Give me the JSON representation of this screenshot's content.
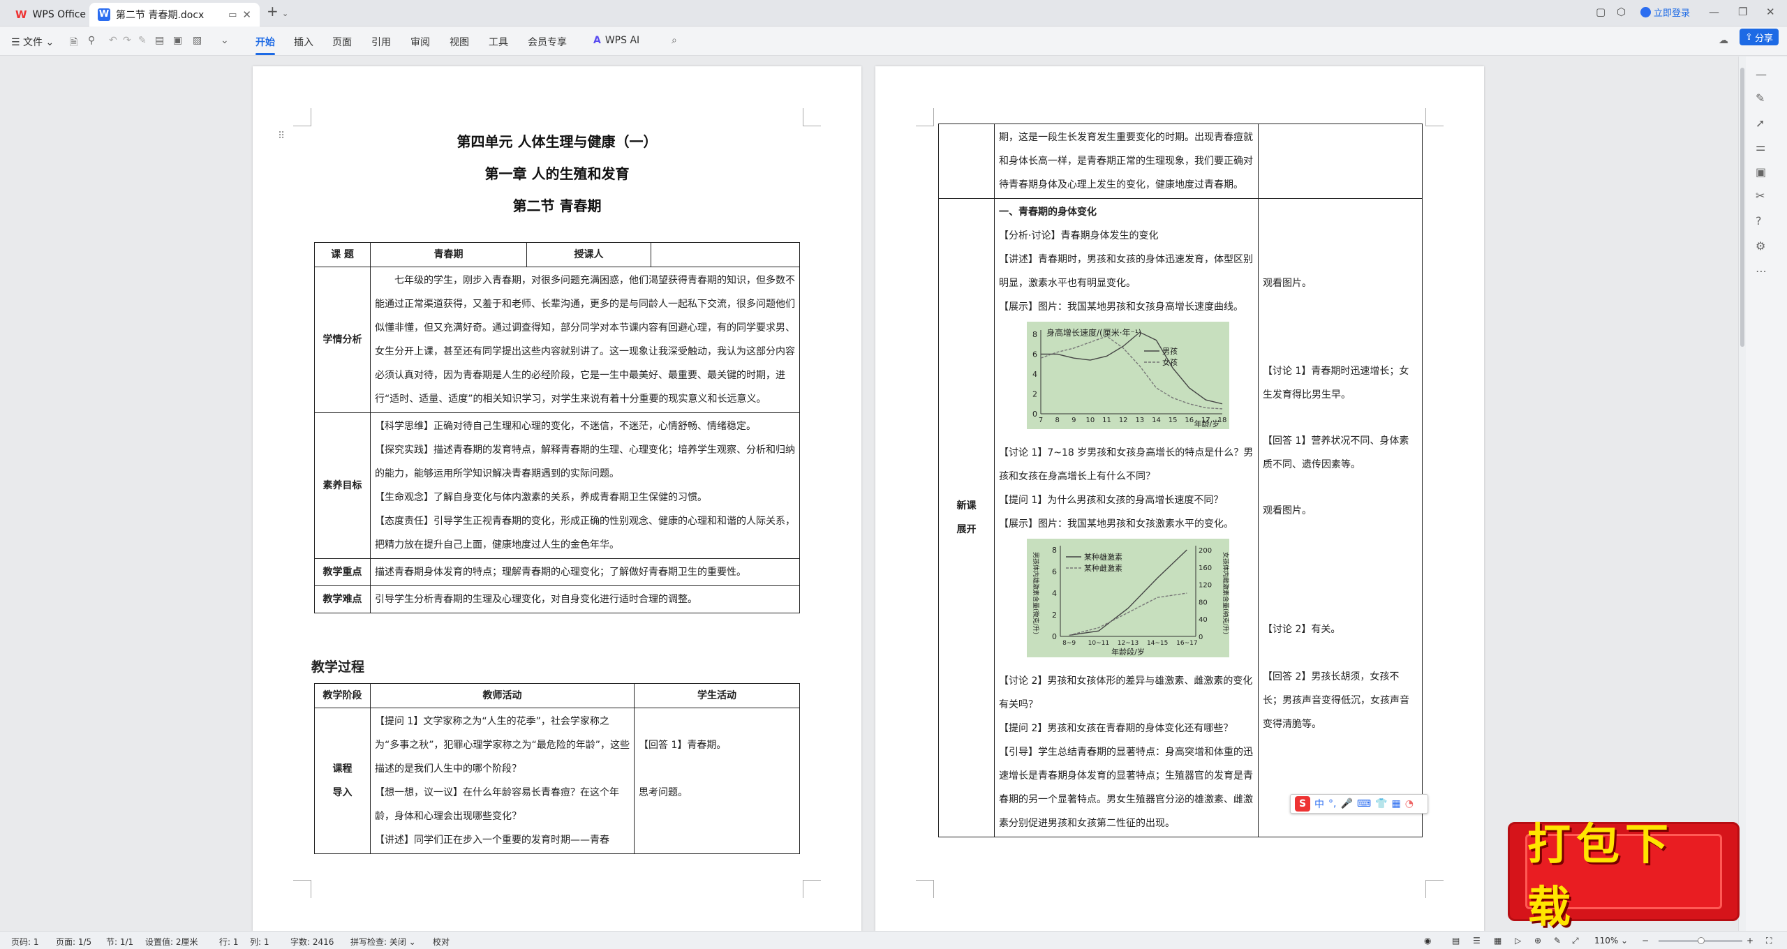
{
  "titlebar": {
    "app_tab": "WPS Office",
    "doc_tab": "第二节  青春期.docx",
    "login": "立即登录"
  },
  "ribbon": {
    "file": "文件",
    "tabs": [
      "开始",
      "插入",
      "页面",
      "引用",
      "审阅",
      "视图",
      "工具",
      "会员专享"
    ],
    "ai": "WPS AI",
    "share": "分享"
  },
  "page1": {
    "title1": "第四单元  人体生理与健康（一）",
    "title2": "第一章  人的生殖和发育",
    "title3": "第二节  青春期",
    "info": {
      "h_topic": "课    题",
      "topic": "青春期",
      "h_teacher": "授课人",
      "teacher": "",
      "h_xq": "学情分析",
      "xq": "七年级的学生，刚步入青春期，对很多问题充满困惑，他们渴望获得青春期的知识，但多数不能通过正常渠道获得，又羞于和老师、长辈沟通，更多的是与同龄人一起私下交流，很多问题他们似懂非懂，但又充满好奇。通过调查得知，部分同学对本节课内容有回避心理，有的同学要求男、女生分开上课，甚至还有同学提出这些内容就别讲了。这一现象让我深受触动，我认为这部分内容必须认真对待，因为青春期是人生的必经阶段，它是一生中最美好、最重要、最关键的时期，进行“适时、适量、适度”的相关知识学习，对学生来说有着十分重要的现实意义和长远意义。",
      "h_sy": "素养目标",
      "sy": [
        "【科学思维】正确对待自己生理和心理的变化，不迷信，不迷茫，心情舒畅、情绪稳定。",
        "【探究实践】描述青春期的发育特点，解释青春期的生理、心理变化；培养学生观察、分析和归纳的能力，能够运用所学知识解决青春期遇到的实际问题。",
        "【生命观念】了解自身变化与体内激素的关系，养成青春期卫生保健的习惯。",
        "【态度责任】引导学生正视青春期的变化，形成正确的性别观念、健康的心理和和谐的人际关系，把精力放在提升自己上面，健康地度过人生的金色年华。"
      ],
      "h_zd": "教学重点",
      "zd": "描述青春期身体发育的特点；理解青春期的心理变化；了解做好青春期卫生的重要性。",
      "h_nd": "教学难点",
      "nd": "引导学生分析青春期的生理及心理变化，对自身变化进行适时合理的调整。"
    },
    "process_heading": "教学过程",
    "process": {
      "h_stage": "教学阶段",
      "h_teacher": "教师活动",
      "h_student": "学生活动",
      "stage1": "课程\n导入",
      "t1": [
        "【提问 1】文学家称之为“人生的花季”，社会学家称之为“多事之秋”，犯罪心理学家称之为“最危险的年龄”，这些描述的是我们人生中的哪个阶段？",
        "【想一想，议一议】在什么年龄容易长青春痘？在这个年龄，身体和心理会出现哪些变化？",
        "【讲述】同学们正在步入一个重要的发育时期——青春"
      ],
      "s1": [
        "【回答 1】青春期。",
        "思考问题。"
      ]
    }
  },
  "page2": {
    "cont_teacher": "期，这是一段生长发育发生重要变化的时期。出现青春痘就和身体长高一样，是青春期正常的生理现象，我们要正确对待青春期身体及心理上发生的变化，健康地度过青春期。",
    "stage2": "新课\n展开",
    "sec1": "一、青春期的身体变化",
    "t_lines": [
      "【分析·讨论】青春期身体发生的变化",
      "【讲述】青春期时，男孩和女孩的身体迅速发育，体型区别明显，激素水平也有明显变化。",
      "【展示】图片：我国某地男孩和女孩身高增长速度曲线。"
    ],
    "t_lines2": [
      "【讨论 1】7~18 岁男孩和女孩身高增长的特点是什么？男孩和女孩在身高增长上有什么不同？",
      "【提问 1】为什么男孩和女孩的身高增长速度不同？",
      "【展示】图片：我国某地男孩和女孩激素水平的变化。"
    ],
    "t_lines3": [
      "【讨论 2】男孩和女孩体形的差异与雄激素、雌激素的变化有关吗？",
      "【提问 2】男孩和女孩在青春期的身体变化还有哪些？",
      "【引导】学生总结青春期的显著特点：身高突增和体重的迅速增长是青春期身体发育的显著特点；生殖器官的发育是青春期的另一个显著特点。男女生殖器官分泌的雄激素、雌激素分别促进男孩和女孩第二性征的出现。"
    ],
    "s_lines": {
      "a": "观看图片。",
      "b": "【讨论 1】青春期时迅速增长；女生发育得比男生早。",
      "c": "【回答 1】营养状况不同、身体素质不同、遗传因素等。",
      "d": "观看图片。",
      "e": "【讨论 2】有关。",
      "f": "【回答 2】男孩长胡须，女孩不长；男孩声音变得低沉，女孩声音变得清脆等。"
    }
  },
  "chart_data": [
    {
      "type": "line",
      "title": "身高增长速度/(厘米·年⁻¹)",
      "xlabel": "年龄/岁",
      "x": [
        7,
        8,
        9,
        10,
        11,
        12,
        13,
        14,
        15,
        16,
        17,
        18
      ],
      "ylim": [
        0,
        8
      ],
      "yticks": [
        0,
        2,
        4,
        6,
        8
      ],
      "series": [
        {
          "name": "男孩",
          "values": [
            6,
            6,
            5.6,
            5.4,
            5.8,
            6.8,
            8.2,
            7.4,
            4.6,
            2.6,
            1.4,
            1.0
          ]
        },
        {
          "name": "女孩",
          "values": [
            5.6,
            6.2,
            6.6,
            7.2,
            7.8,
            6.6,
            4.8,
            2.6,
            1.6,
            1.0,
            0.6,
            0.5
          ]
        }
      ]
    },
    {
      "type": "line",
      "title": "",
      "ylabel": "男孩体内雄激素含量(微克/升)",
      "ylabel_right": "女孩体内雌激素含量(纳克/升)",
      "xlabel": "年龄段/岁",
      "x": [
        "8~9",
        "10~11",
        "12~13",
        "14~15",
        "16~17"
      ],
      "ylim": [
        0,
        8
      ],
      "yticks": [
        0,
        2,
        4,
        6,
        8
      ],
      "ylim_right": [
        0,
        200
      ],
      "yticks_right": [
        0,
        40,
        80,
        120,
        160,
        200
      ],
      "series": [
        {
          "name": "某种雄激素",
          "values": [
            0.1,
            0.5,
            2.6,
            5.4,
            8.0
          ]
        },
        {
          "name": "某种雌激素",
          "values": [
            0.1,
            0.8,
            2.2,
            3.6,
            4.0
          ]
        }
      ]
    }
  ],
  "ime": {
    "lang": "中",
    "punc": "°,"
  },
  "banner": {
    "text": "打包下载"
  },
  "statusbar": {
    "page_no": "页码: 1",
    "pages": "页面: 1/5",
    "section": "节: 1/1",
    "setting": "设置值: 2厘米",
    "row": "行: 1",
    "col": "列: 1",
    "words": "字数: 2416",
    "spell": "拼写检查: 关闭",
    "proof": "校对",
    "zoom": "110%"
  }
}
